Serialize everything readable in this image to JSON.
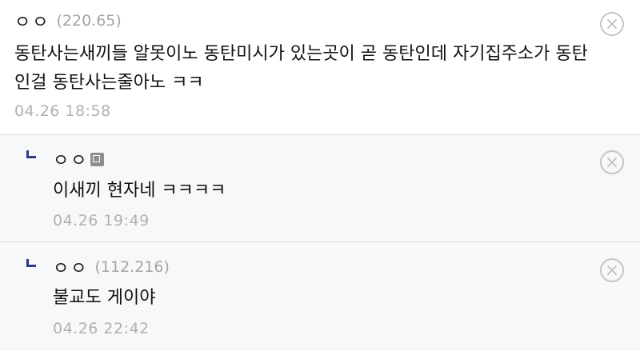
{
  "comments": [
    {
      "nickname": "ㅇㅇ",
      "ip": "(220.65)",
      "text": "동탄사는새끼들 알못이노 동탄미시가 있는곳이 곧 동탄인데 자기집주소가 동탄인걸 동탄사는줄아노 ㅋㅋ",
      "date": "04.26 18:58",
      "delete_icon": "close-circle-icon"
    },
    {
      "nickname": "ㅇㅇ",
      "ip": "",
      "has_fixed_nick_icon": true,
      "text": "이새끼 현자네 ㅋㅋㅋㅋ",
      "date": "04.26 19:49",
      "reply_icon": "reply-arrow-icon",
      "delete_icon": "close-circle-icon"
    },
    {
      "nickname": "ㅇㅇ",
      "ip": "(112.216)",
      "text": "불교도 게이야",
      "date": "04.26 22:42",
      "reply_icon": "reply-arrow-icon",
      "delete_icon": "close-circle-icon"
    }
  ],
  "colors": {
    "reply_background": "#f7f8fa",
    "reply_marker": "#2b3a8a",
    "meta_text": "#a4a4a4"
  }
}
